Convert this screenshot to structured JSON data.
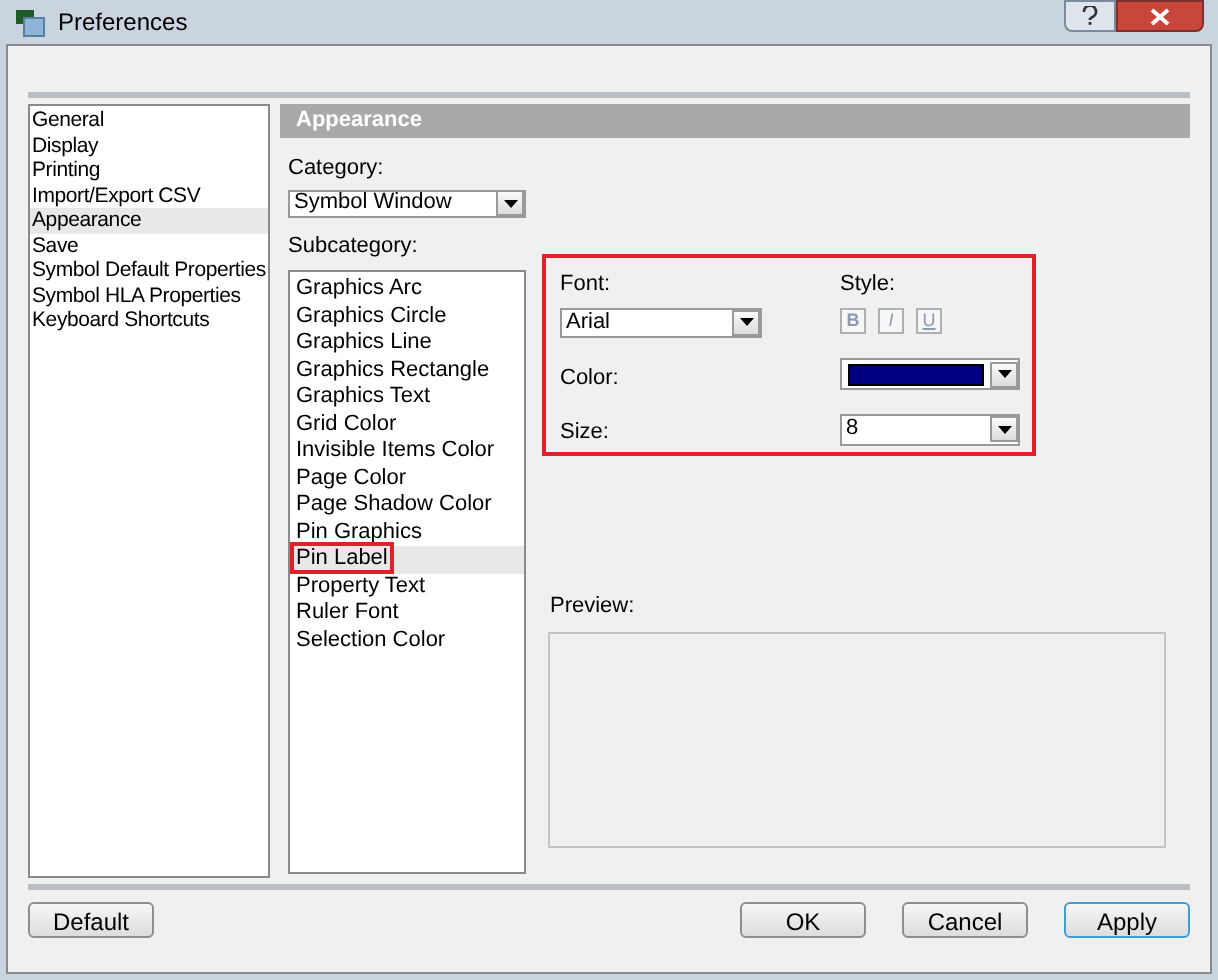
{
  "window": {
    "title": "Preferences"
  },
  "sidebar": {
    "items": [
      {
        "label": "General",
        "selected": false
      },
      {
        "label": "Display",
        "selected": false
      },
      {
        "label": "Printing",
        "selected": false
      },
      {
        "label": "Import/Export CSV",
        "selected": false
      },
      {
        "label": "Appearance",
        "selected": true
      },
      {
        "label": "Save",
        "selected": false
      },
      {
        "label": "Symbol Default Properties",
        "selected": false
      },
      {
        "label": "Symbol HLA Properties",
        "selected": false
      },
      {
        "label": "Keyboard Shortcuts",
        "selected": false
      }
    ]
  },
  "panel": {
    "header": "Appearance",
    "category_label": "Category:",
    "category_value": "Symbol Window",
    "subcategory_label": "Subcategory:",
    "subcategories": [
      {
        "label": "Graphics Arc",
        "selected": false,
        "highlighted": false
      },
      {
        "label": "Graphics Circle",
        "selected": false,
        "highlighted": false
      },
      {
        "label": "Graphics Line",
        "selected": false,
        "highlighted": false
      },
      {
        "label": "Graphics Rectangle",
        "selected": false,
        "highlighted": false
      },
      {
        "label": "Graphics Text",
        "selected": false,
        "highlighted": false
      },
      {
        "label": "Grid Color",
        "selected": false,
        "highlighted": false
      },
      {
        "label": "Invisible Items Color",
        "selected": false,
        "highlighted": false
      },
      {
        "label": "Page Color",
        "selected": false,
        "highlighted": false
      },
      {
        "label": "Page Shadow Color",
        "selected": false,
        "highlighted": false
      },
      {
        "label": "Pin Graphics",
        "selected": false,
        "highlighted": false
      },
      {
        "label": "Pin Label",
        "selected": true,
        "highlighted": true
      },
      {
        "label": "Property Text",
        "selected": false,
        "highlighted": false
      },
      {
        "label": "Ruler Font",
        "selected": false,
        "highlighted": false
      },
      {
        "label": "Selection Color",
        "selected": false,
        "highlighted": false
      }
    ],
    "font_group": {
      "highlighted": true,
      "font_label": "Font:",
      "font_value": "Arial",
      "style_label": "Style:",
      "style_buttons": [
        {
          "label": "B",
          "kind": "bold",
          "disabled": true
        },
        {
          "label": "I",
          "kind": "italic",
          "disabled": true
        },
        {
          "label": "U",
          "kind": "underline",
          "disabled": true
        }
      ],
      "color_label": "Color:",
      "color": "#000080",
      "size_label": "Size:",
      "size_value": "8"
    },
    "preview_label": "Preview:"
  },
  "buttons": [
    {
      "label": "Default",
      "kind": "left",
      "focused": false
    },
    {
      "label": "OK",
      "kind": "right",
      "focused": false
    },
    {
      "label": "Cancel",
      "kind": "right",
      "focused": false
    },
    {
      "label": "Apply",
      "kind": "right",
      "focused": true
    }
  ]
}
